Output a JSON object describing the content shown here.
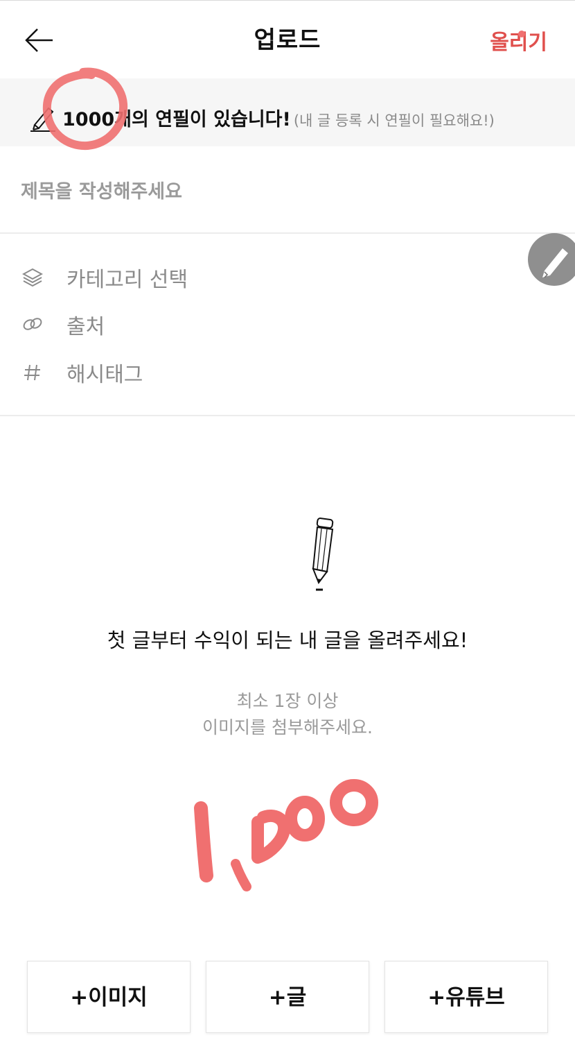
{
  "header": {
    "title": "업로드",
    "post_label": "올리기",
    "back_icon": "arrow-left-icon"
  },
  "notice": {
    "icon": "pencil-icon",
    "count_text": "1000개의 연필이 있습니다!",
    "hint_text": "(내 글 등록 시 연필이 필요해요!)"
  },
  "form": {
    "title_placeholder": "제목을 작성해주세요",
    "category_label": "카테고리 선택",
    "source_label": "출처",
    "hashtag_label": "해시태그"
  },
  "empty_state": {
    "headline": "첫 글부터 수익이 되는 내 글을 올려주세요!",
    "sub_line1": "최소 1장 이상",
    "sub_line2": "이미지를 첨부해주세요."
  },
  "buttons": {
    "add_image": "+이미지",
    "add_text": "+글",
    "add_youtube": "+유튜브"
  },
  "colors": {
    "accent": "#e0504d",
    "annotation": "#f07070",
    "muted_text": "#8a8a8a",
    "notice_bg": "#f6f6f6"
  }
}
